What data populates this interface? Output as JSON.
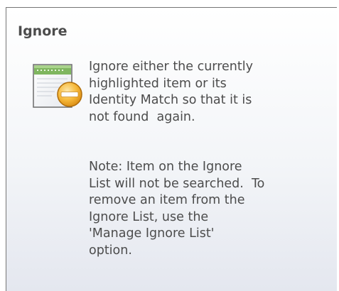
{
  "tooltip": {
    "title": "Ignore",
    "icon": "ignore-list-icon",
    "description": "Ignore either the currently\nhighlighted item or its\nIdentity Match so that it is\nnot found  again.",
    "note": "Note: Item on the Ignore\nList will not be searched.  To\nremove an item from the\nIgnore List, use the\n'Manage Ignore List'\noption."
  },
  "colors": {
    "border": "#767676",
    "text": "#4c4c4c",
    "icon_accent": "#f2a531",
    "icon_green": "#5c9c3e"
  }
}
